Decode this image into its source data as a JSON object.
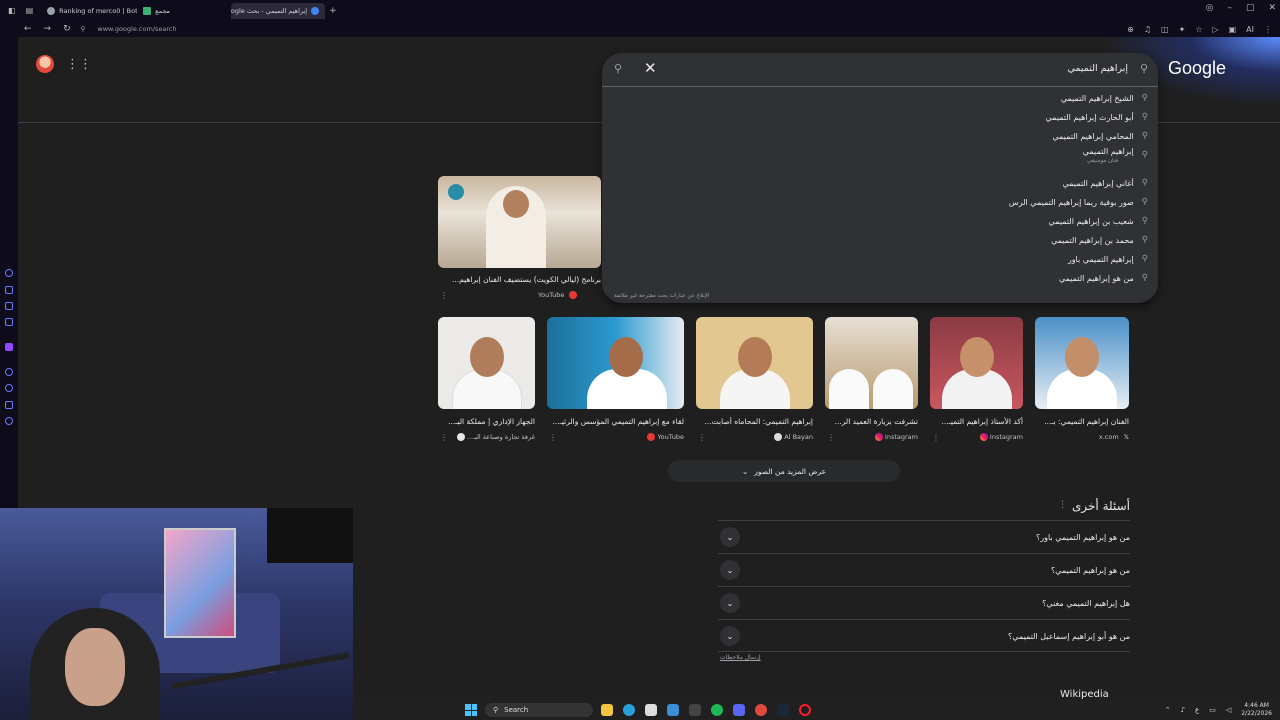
{
  "browser": {
    "tabs": [
      {
        "label": "Ranking of merco0 | Botf...",
        "color": "#9aa0a6"
      },
      {
        "label": "مجمع",
        "color": "#3bb273"
      },
      {
        "label": "إبراهيم التميمي - بحث Google",
        "color": "#4285f4"
      }
    ],
    "new_tab": "+",
    "url": "www.google.com/search",
    "ai_label": "AI"
  },
  "google": {
    "logo": "Google",
    "query": "إبراهيم التميمي",
    "suggestions": [
      {
        "text": "الشيخ إبراهيم التميمي",
        "sub": ""
      },
      {
        "text": "أبو الحارث إبراهيم التميمي",
        "sub": ""
      },
      {
        "text": "المحامي إبراهيم التميمي",
        "sub": ""
      },
      {
        "text": "إبراهيم التميمي",
        "sub": "فنان موسيقي"
      },
      {
        "text": "أغاني إبراهيم التميمي",
        "sub": ""
      },
      {
        "text": "صور بوفية ريما إبراهيم التميمي الرس",
        "sub": ""
      },
      {
        "text": "شعيب بن إبراهيم التميمي",
        "sub": ""
      },
      {
        "text": "محمد بن إبراهيم التميمي",
        "sub": ""
      },
      {
        "text": "إبراهيم التميمي باور",
        "sub": ""
      },
      {
        "text": "من هو إبراهيم التميمي",
        "sub": ""
      }
    ],
    "report_text": "الإبلاغ عن عبارات بحث مقترحة غير ملائمة"
  },
  "video": {
    "title": "برنامج (ليالي الكويت) يستضيف الفنان إبراهيم...",
    "source": "YouTube"
  },
  "images": [
    {
      "caption": "الجهاز الإداري | مملكة البـ...",
      "source": "غرفة تجارة وصناعة البـ..."
    },
    {
      "caption": "لقاء مع إبراهيم التميمي المؤسس والرئيـ...",
      "source": "YouTube"
    },
    {
      "caption": "إبراهيم التميمي: المحاماه أصابت...",
      "source": "Al Bayan"
    },
    {
      "caption": "تشرفت بزيارة العميد الر...",
      "source": "Instagram"
    },
    {
      "caption": "أكد الأستاذ إبراهيم التميـ...",
      "source": "Instagram"
    },
    {
      "caption": "الفنان إبراهيم التميمي: بـ...",
      "source": "x.com"
    }
  ],
  "more_images": "عرض المزيد من الصور",
  "paa": {
    "title": "أسئلة أخرى",
    "questions": [
      "من هو إبراهيم التميمي باور؟",
      "من هو إبراهيم التميمي؟",
      "هل إبراهيم التميمي مغني؟",
      "من هو أبو إبراهيم إسماعيل التميمي؟"
    ],
    "feedback": "إرسال ملاحظات"
  },
  "wikipedia": "Wikipedia",
  "taskbar": {
    "search": "Search",
    "lang": "ع",
    "time": "4:46 AM",
    "date": "2/22/2026"
  },
  "colors": {
    "accent": "#4285f4",
    "page_bg": "#1f1f1f",
    "panel_bg": "#303134",
    "browser_chrome": "#0e0b1a"
  }
}
